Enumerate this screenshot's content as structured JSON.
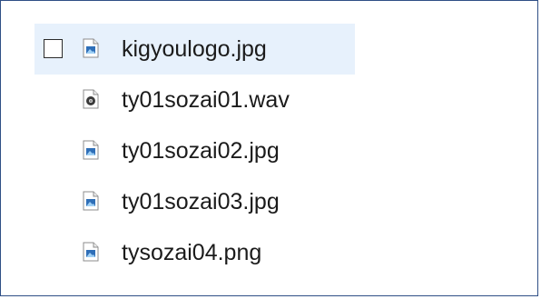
{
  "files": [
    {
      "name": "kigyoulogo.jpg",
      "type": "image",
      "icon": "image-file-icon",
      "selected": true
    },
    {
      "name": "ty01sozai01.wav",
      "type": "audio",
      "icon": "audio-file-icon",
      "selected": false
    },
    {
      "name": "ty01sozai02.jpg",
      "type": "image",
      "icon": "image-file-icon",
      "selected": false
    },
    {
      "name": "ty01sozai03.jpg",
      "type": "image",
      "icon": "image-file-icon",
      "selected": false
    },
    {
      "name": "tysozai04.png",
      "type": "image",
      "icon": "image-file-icon",
      "selected": false
    }
  ],
  "colors": {
    "selection_background": "#e7f1fc",
    "frame_border": "#2f4f86",
    "text": "#1b1b1b"
  }
}
